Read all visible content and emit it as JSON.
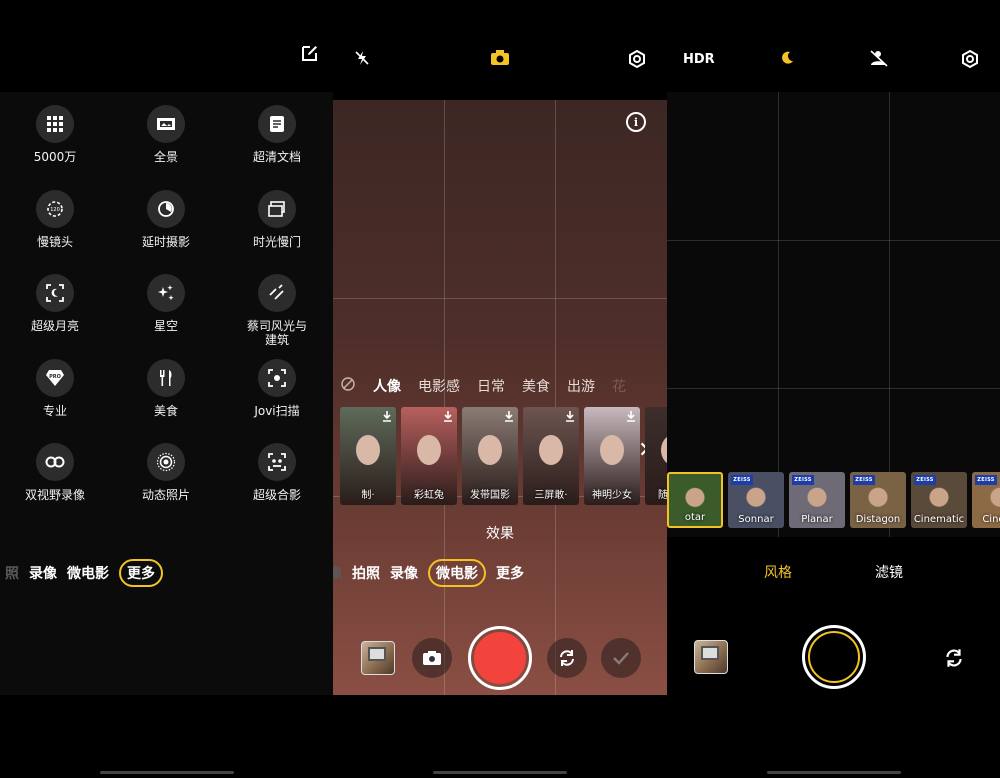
{
  "panel1": {
    "grid": [
      {
        "label": "5000万",
        "icon": "grid-icon"
      },
      {
        "label": "全景",
        "icon": "panorama-icon"
      },
      {
        "label": "超清文档",
        "icon": "document-icon"
      },
      {
        "label": "慢镜头",
        "icon": "slow-motion-icon"
      },
      {
        "label": "延时摄影",
        "icon": "timelapse-icon"
      },
      {
        "label": "时光慢门",
        "icon": "slow-shutter-icon"
      },
      {
        "label": "超级月亮",
        "icon": "super-moon-icon"
      },
      {
        "label": "星空",
        "icon": "starry-sky-icon"
      },
      {
        "label": "蔡司风光与\n建筑",
        "icon": "zeiss-landscape-icon"
      },
      {
        "label": "专业",
        "icon": "pro-icon"
      },
      {
        "label": "美食",
        "icon": "food-icon"
      },
      {
        "label": "Jovi扫描",
        "icon": "scan-icon"
      },
      {
        "label": "双视野录像",
        "icon": "dual-view-icon"
      },
      {
        "label": "动态照片",
        "icon": "live-photo-icon"
      },
      {
        "label": "超级合影",
        "icon": "group-photo-icon"
      }
    ],
    "modes": [
      "照",
      "录像",
      "微电影",
      "更多"
    ],
    "active_mode": "更多"
  },
  "panel2": {
    "categories": [
      "人像",
      "电影感",
      "日常",
      "美食",
      "出游",
      "花"
    ],
    "active_category": "人像",
    "templates": [
      {
        "label": "制·",
        "bg": "#5e6b5a"
      },
      {
        "label": "彩虹兔",
        "bg": "#b8605e"
      },
      {
        "label": "发带国影",
        "bg": "#8a7b74"
      },
      {
        "label": "三屏敢·",
        "bg": "#6d5550"
      },
      {
        "label": "神明少女",
        "bg": "#c7b9bd"
      },
      {
        "label": "随性艺",
        "bg": "#3b2e2b"
      }
    ],
    "effect_label": "效果",
    "modes": [
      "像",
      "拍照",
      "录像",
      "微电影",
      "更多"
    ],
    "active_mode": "微电影",
    "colors": {
      "record": "#f2443d",
      "accent": "#f3c224"
    }
  },
  "panel3": {
    "hdr_label": "HDR",
    "styles": [
      {
        "label": "otar",
        "bg": "#3b5c2a",
        "zeiss": false
      },
      {
        "label": "Sonnar",
        "bg": "#4a4f63",
        "zeiss": true
      },
      {
        "label": "Planar",
        "bg": "#6e6a76",
        "zeiss": true
      },
      {
        "label": "Distagon",
        "bg": "#7a6245",
        "zeiss": true
      },
      {
        "label": "Cinematic",
        "bg": "#5a4a3a",
        "zeiss": true
      },
      {
        "label": "Cine-fl·",
        "bg": "#8c6a45",
        "zeiss": true
      }
    ],
    "zeiss_text": "ZEISS",
    "tabs": [
      "风格",
      "滤镜"
    ],
    "active_tab": "风格"
  }
}
